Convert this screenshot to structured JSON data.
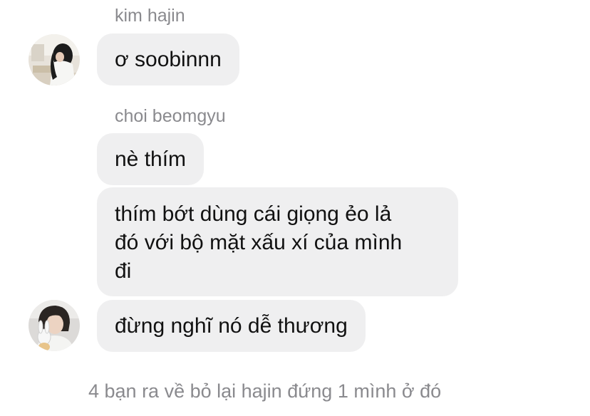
{
  "chat": {
    "groups": [
      {
        "sender": "kim hajin",
        "avatar_icon": "girl-profile-avatar-icon",
        "messages": [
          "ơ soobinnn"
        ]
      },
      {
        "sender": "choi beomgyu",
        "avatar_icon": "boy-with-plush-avatar-icon",
        "messages": [
          "nè thím",
          [
            "thím bớt dùng cái giọng ẻo lả",
            "đó với bộ mặt xấu xí của mình",
            "đi"
          ],
          "đừng nghĩ nó dễ thương"
        ]
      }
    ]
  },
  "caption": "4 bạn ra về bỏ lại hajin đứng 1 mình ở đó",
  "colors": {
    "bubble": "#efeff0",
    "sender_name": "#8a8a8e",
    "message_text": "#111111",
    "background": "#ffffff"
  }
}
